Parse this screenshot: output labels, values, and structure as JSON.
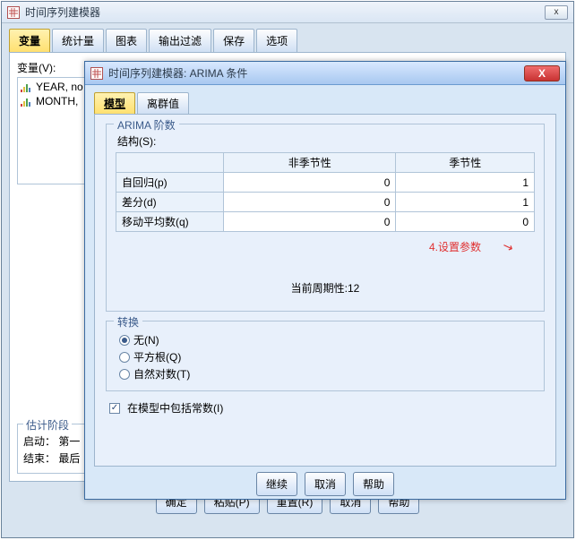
{
  "outer": {
    "title": "时间序列建模器",
    "minimize": "x",
    "tabs": [
      "变量",
      "统计量",
      "图表",
      "输出过滤",
      "保存",
      "选项"
    ],
    "active_tab": 0,
    "var_label": "变量(V):",
    "var_items": [
      "YEAR, no",
      "MONTH,"
    ],
    "est_group_title": "估计阶段",
    "est_start": "启动：  第一",
    "est_end": "结束：  最后",
    "buttons": {
      "ok": "确定",
      "paste": "粘贴(P)",
      "reset": "重置(R)",
      "cancel": "取消",
      "help": "帮助"
    }
  },
  "dialog": {
    "title": "时间序列建模器: ARIMA 条件",
    "close": "X",
    "tabs": [
      "模型",
      "离群值"
    ],
    "active_tab": 0,
    "arima_group": "ARIMA 阶数",
    "structure_label": "结构(S):",
    "headers": {
      "nonseasonal": "非季节性",
      "seasonal": "季节性"
    },
    "rows": [
      {
        "name": "自回归(p)",
        "ns": 0,
        "s": 1
      },
      {
        "name": "差分(d)",
        "ns": 0,
        "s": 1
      },
      {
        "name": "移动平均数(q)",
        "ns": 0,
        "s": 0
      }
    ],
    "periodicity": "当前周期性:12",
    "annotation": "4.设置参数",
    "transform_group": "转换",
    "transform_options": [
      {
        "label": "无(N)",
        "selected": true
      },
      {
        "label": "平方根(Q)",
        "selected": false
      },
      {
        "label": "自然对数(T)",
        "selected": false
      }
    ],
    "include_const": {
      "label": "在模型中包括常数(I)",
      "checked": true
    },
    "buttons": {
      "cont": "继续",
      "cancel": "取消",
      "help": "帮助"
    }
  },
  "chart_data": {
    "type": "table",
    "title": "ARIMA 阶数 结构(S)",
    "columns": [
      "",
      "非季节性",
      "季节性"
    ],
    "rows": [
      [
        "自回归(p)",
        0,
        1
      ],
      [
        "差分(d)",
        0,
        1
      ],
      [
        "移动平均数(q)",
        0,
        0
      ]
    ],
    "periodicity": 12
  }
}
